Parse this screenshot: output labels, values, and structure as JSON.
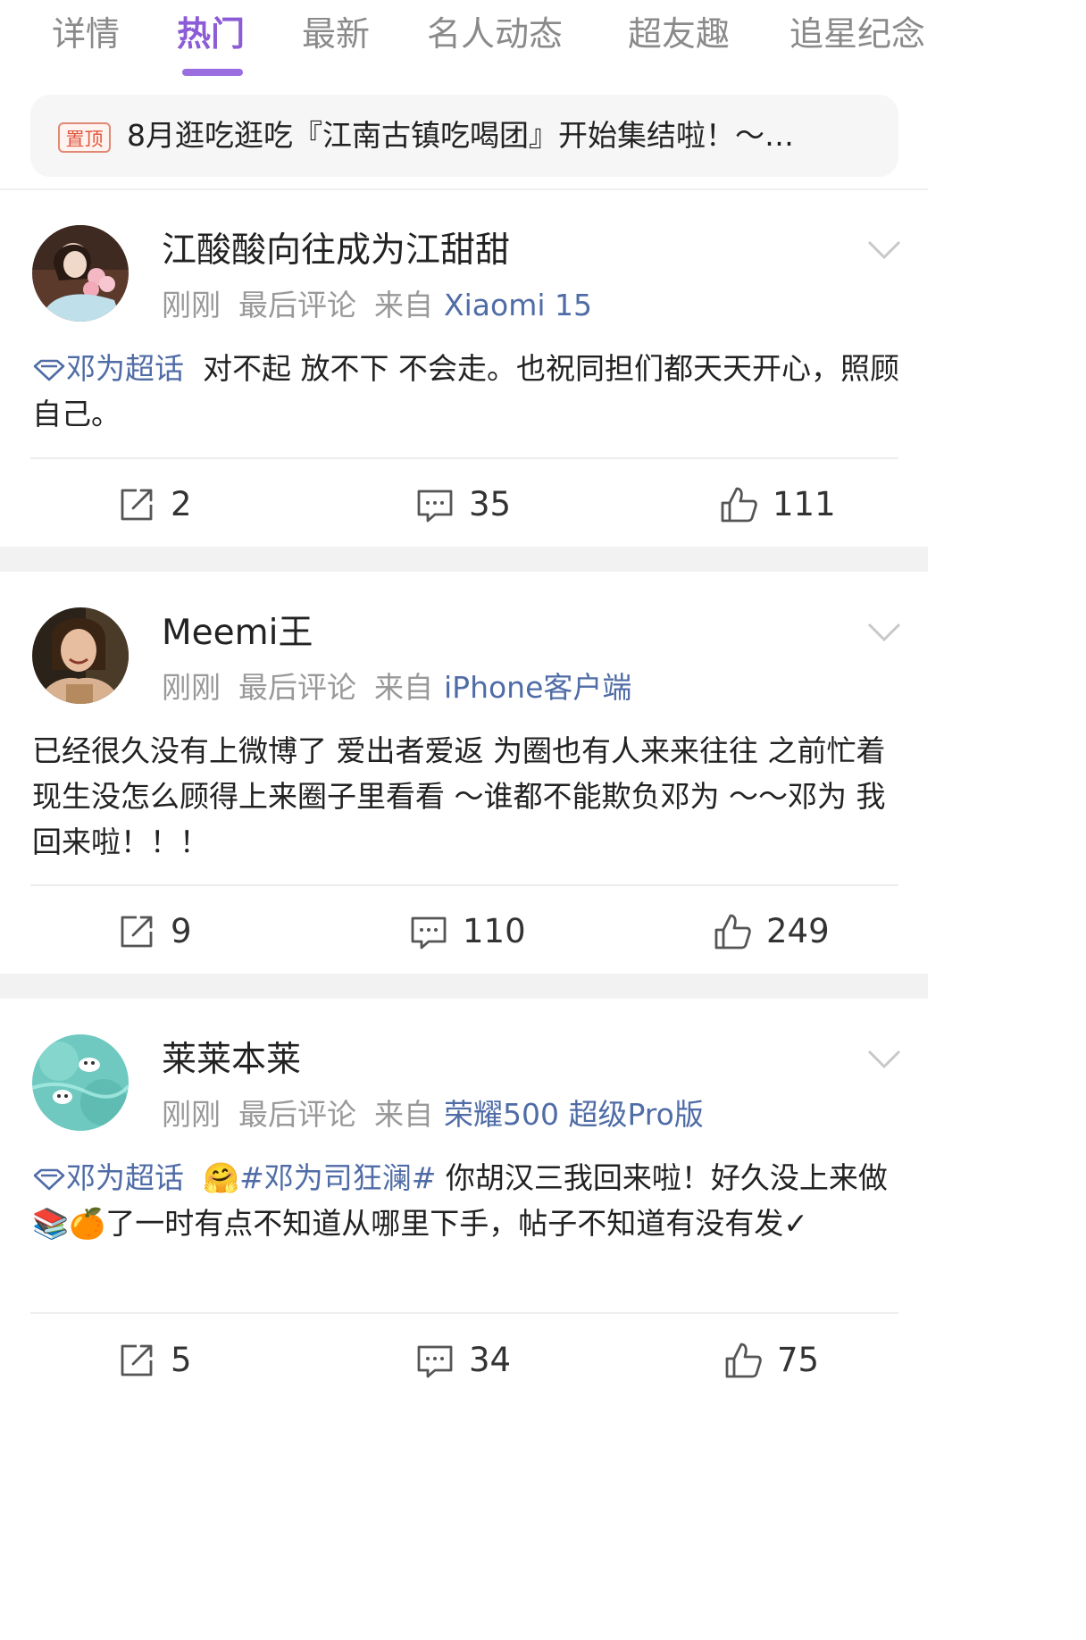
{
  "tabs": [
    {
      "label": "详情"
    },
    {
      "label": "热门"
    },
    {
      "label": "最新"
    },
    {
      "label": "名人动态"
    },
    {
      "label": "超友趣"
    },
    {
      "label": "追星纪念"
    }
  ],
  "active_tab": "热门",
  "pinned": {
    "badge": "置顶",
    "text": "8月逛吃逛吃『江南古镇吃喝团』开始集结啦！～…"
  },
  "posts": [
    {
      "username": "江酸酸向往成为江甜甜",
      "time": "刚刚",
      "last_comment": "最后评论",
      "from_label": "来自",
      "device": "Xiaomi 15",
      "supertopic": "邓为超话",
      "text": "对不起 放不下 不会走。也祝同担们都天天开心，照顾自己。",
      "reposts": "2",
      "comments": "35",
      "likes": "111"
    },
    {
      "username": "Meemi王",
      "time": "刚刚",
      "last_comment": "最后评论",
      "from_label": "来自",
      "device": "iPhone客户端",
      "text": "已经很久没有上微博了 爱出者爱返 为圈也有人来来往往 之前忙着现生没怎么顾得上来圈子里看看 ～谁都不能欺负邓为 ～～邓为 我回来啦！！！",
      "reposts": "9",
      "comments": "110",
      "likes": "249"
    },
    {
      "username": "莱莱本莱",
      "time": "刚刚",
      "last_comment": "最后评论",
      "from_label": "来自",
      "device": "荣耀500 超级Pro版",
      "supertopic": "邓为超话",
      "emoji_hug": "🤗",
      "hashtag": "#邓为司狂澜#",
      "text_a": "你胡汉三我回来啦！好久没上来做",
      "emoji_books": "📚",
      "emoji_orange": "🍊",
      "text_b": "了一时有点不知道从哪里下手，帖子不知道有没有发✓",
      "reposts": "5",
      "comments": "34",
      "likes": "75"
    }
  ],
  "colors": {
    "accent": "#8c5cd6",
    "link": "#506ca6",
    "meta": "#999999",
    "separator": "#f2f2f2"
  },
  "icons": [
    "supertopic-diamond-icon",
    "repost-icon",
    "comment-icon",
    "like-icon",
    "chevron-down-icon"
  ]
}
